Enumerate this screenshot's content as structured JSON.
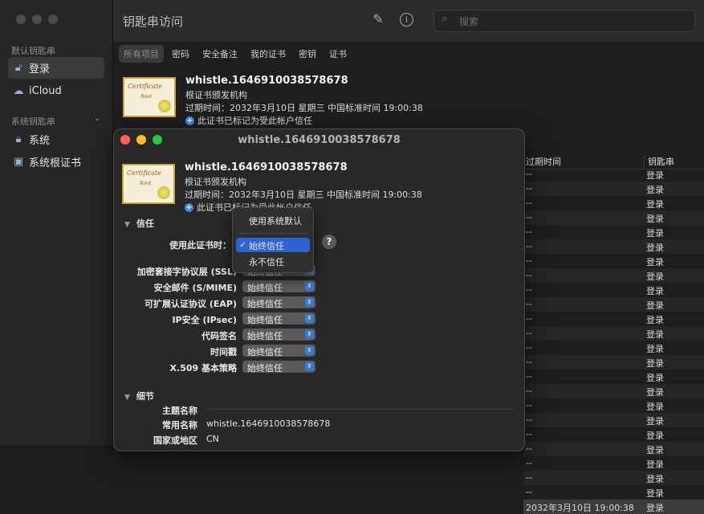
{
  "window": {
    "title": "钥匙串访问"
  },
  "sidebar": {
    "default_head": "默认钥匙串",
    "system_head": "系统钥匙串",
    "items": [
      {
        "label": "登录",
        "icon": "lock-open-icon"
      },
      {
        "label": "iCloud",
        "icon": "cloud-icon"
      },
      {
        "label": "系统",
        "icon": "lock-icon"
      },
      {
        "label": "系统根证书",
        "icon": "folder-icon"
      }
    ]
  },
  "search": {
    "placeholder": "搜索"
  },
  "tabs": [
    "所有项目",
    "密码",
    "安全备注",
    "我的证书",
    "密钥",
    "证书"
  ],
  "cert_header": {
    "name": "whistle.1646910038578678",
    "kind": "根证书颁发机构",
    "expires": "过期时间：2032年3月10日 星期三 中国标准时间 19:00:38",
    "trust_note": "此证书已标记为受此帐户信任"
  },
  "cert_icon": {
    "line1": "Certificate",
    "line2": "Root"
  },
  "list": {
    "col_expires": "过期时间",
    "col_keychain": "钥匙串",
    "rows": [
      {
        "exp": "--",
        "kc": "登录"
      },
      {
        "exp": "--",
        "kc": "登录"
      },
      {
        "exp": "--",
        "kc": "登录"
      },
      {
        "exp": "--",
        "kc": "登录"
      },
      {
        "exp": "--",
        "kc": "登录"
      },
      {
        "exp": "--",
        "kc": "登录"
      },
      {
        "exp": "--",
        "kc": "登录"
      },
      {
        "exp": "--",
        "kc": "登录"
      },
      {
        "exp": "--",
        "kc": "登录"
      },
      {
        "exp": "--",
        "kc": "登录"
      },
      {
        "exp": "--",
        "kc": "登录"
      },
      {
        "exp": "--",
        "kc": "登录"
      },
      {
        "exp": "--",
        "kc": "登录"
      },
      {
        "exp": "--",
        "kc": "登录"
      },
      {
        "exp": "--",
        "kc": "登录"
      },
      {
        "exp": "--",
        "kc": "登录"
      },
      {
        "exp": "--",
        "kc": "登录"
      },
      {
        "exp": "--",
        "kc": "登录"
      },
      {
        "exp": "--",
        "kc": "登录"
      },
      {
        "exp": "--",
        "kc": "登录"
      },
      {
        "exp": "--",
        "kc": "登录"
      },
      {
        "exp": "--",
        "kc": "登录"
      },
      {
        "exp": "--",
        "kc": "登录"
      },
      {
        "exp": "2032年3月10日 19:00:38",
        "kc": "登录"
      }
    ]
  },
  "dialog": {
    "title": "whistle.1646910038578678",
    "trust_section": "信任",
    "use_label": "使用此证书时：",
    "policies": [
      {
        "label": "加密套接字协议层 (SSL)",
        "value": "始终信任"
      },
      {
        "label": "安全邮件 (S/MIME)",
        "value": "始终信任"
      },
      {
        "label": "可扩展认证协议 (EAP)",
        "value": "始终信任"
      },
      {
        "label": "IP安全 (IPsec)",
        "value": "始终信任"
      },
      {
        "label": "代码签名",
        "value": "始终信任"
      },
      {
        "label": "时间戳",
        "value": "始终信任"
      },
      {
        "label": "X.509 基本策略",
        "value": "始终信任"
      }
    ],
    "details_section": "细节",
    "details": [
      {
        "label": "主题名称",
        "value": ""
      },
      {
        "label": "常用名称",
        "value": "whistle.1646910038578678"
      },
      {
        "label": "国家或地区",
        "value": "CN"
      }
    ]
  },
  "trust_menu": {
    "items": [
      "使用系统默认",
      "始终信任",
      "永不信任"
    ],
    "selected": "始终信任"
  },
  "colors": {
    "close": "#ff5f57",
    "minimize": "#febc2e",
    "zoom": "#28c840",
    "accent": "#2f62d3"
  }
}
